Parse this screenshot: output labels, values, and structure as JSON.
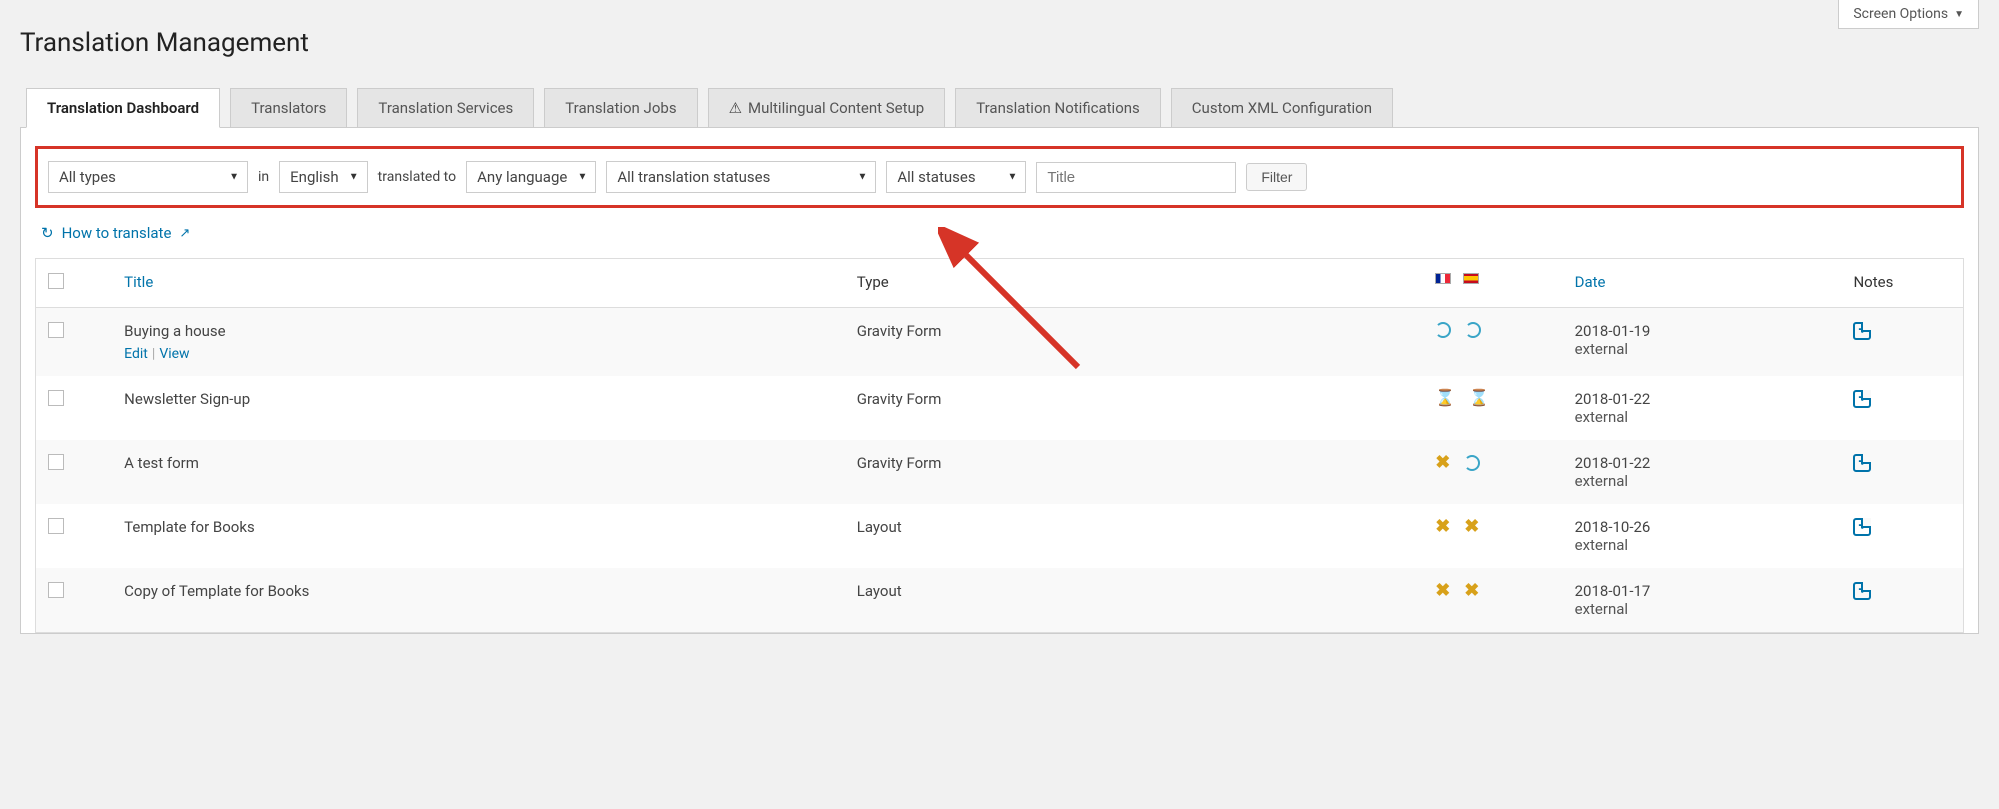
{
  "screenOptions": "Screen Options",
  "pageTitle": "Translation Management",
  "tabs": [
    {
      "label": "Translation Dashboard",
      "active": true,
      "warn": false
    },
    {
      "label": "Translators",
      "active": false,
      "warn": false
    },
    {
      "label": "Translation Services",
      "active": false,
      "warn": false
    },
    {
      "label": "Translation Jobs",
      "active": false,
      "warn": false
    },
    {
      "label": "Multilingual Content Setup",
      "active": false,
      "warn": true
    },
    {
      "label": "Translation Notifications",
      "active": false,
      "warn": false
    },
    {
      "label": "Custom XML Configuration",
      "active": false,
      "warn": false
    }
  ],
  "filters": {
    "type": "All types",
    "inLabel": "in",
    "lang": "English",
    "toLabel": "translated to",
    "targetLang": "Any language",
    "translationStatus": "All translation statuses",
    "status": "All statuses",
    "titlePlaceholder": "Title",
    "filterBtn": "Filter"
  },
  "howTo": "How to translate",
  "columns": {
    "title": "Title",
    "type": "Type",
    "date": "Date",
    "notes": "Notes"
  },
  "rowActions": {
    "edit": "Edit",
    "view": "View"
  },
  "rows": [
    {
      "title": "Buying a house",
      "type": "Gravity Form",
      "fr": "cycle",
      "es": "cycle",
      "date": "2018-01-19",
      "origin": "external",
      "showActions": true
    },
    {
      "title": "Newsletter Sign-up",
      "type": "Gravity Form",
      "fr": "hourglass",
      "es": "hourglass",
      "date": "2018-01-22",
      "origin": "external",
      "showActions": false
    },
    {
      "title": "A test form",
      "type": "Gravity Form",
      "fr": "x",
      "es": "cycle",
      "date": "2018-01-22",
      "origin": "external",
      "showActions": false
    },
    {
      "title": "Template for Books",
      "type": "Layout",
      "fr": "x",
      "es": "x",
      "date": "2018-10-26",
      "origin": "external",
      "showActions": false
    },
    {
      "title": "Copy of Template for Books",
      "type": "Layout",
      "fr": "x",
      "es": "x",
      "date": "2018-01-17",
      "origin": "external",
      "showActions": false
    }
  ]
}
